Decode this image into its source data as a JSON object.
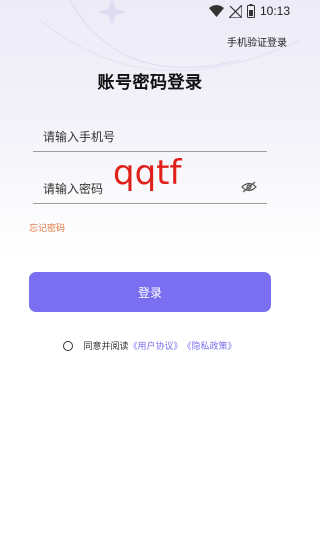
{
  "status_bar": {
    "time": "10:13"
  },
  "header": {
    "alt_login_link": "手机验证登录",
    "title": "账号密码登录"
  },
  "form": {
    "phone_placeholder": "请输入手机号",
    "password_placeholder": "请输入密码",
    "handwriting": "qqtf",
    "forgot_label": "忘记密码",
    "login_label": "登录"
  },
  "agreement": {
    "prefix": "同意并阅读",
    "user_agreement": "《用户协议》",
    "privacy_policy": "《隐私政策》"
  },
  "colors": {
    "accent": "#7a6ff0",
    "forgot": "#e0753c",
    "handwriting": "#e0201a"
  }
}
